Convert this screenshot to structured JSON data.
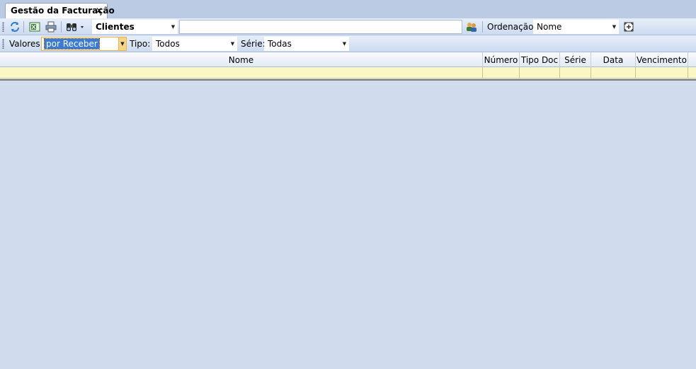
{
  "tab": {
    "title": "Gestão da Facturação",
    "close_glyph": "✕"
  },
  "toolbar": {
    "icons": [
      "refresh-icon",
      "excel-icon",
      "print-icon",
      "binoculars-icon",
      "contacts-icon",
      "columns-icon"
    ],
    "entity_select": {
      "value": "Clientes"
    },
    "search_input": {
      "value": ""
    },
    "order_label": "Ordenação:",
    "order_select": {
      "value": "Nome"
    }
  },
  "filters": {
    "valores_label": "Valores:",
    "valores_select": {
      "value": "por Receber"
    },
    "tipo_label": "Tipo:",
    "tipo_select": {
      "value": "Todos"
    },
    "serie_label": "Série:",
    "serie_select": {
      "value": "Todas"
    }
  },
  "grid": {
    "columns": [
      "Nome",
      "Número",
      "Tipo Doc",
      "Série",
      "Data",
      "Vencimento"
    ]
  },
  "colors": {
    "background": "#d0dcee",
    "filter_row": "#fbf7c4",
    "selected_highlight": "#3a7bd5"
  }
}
